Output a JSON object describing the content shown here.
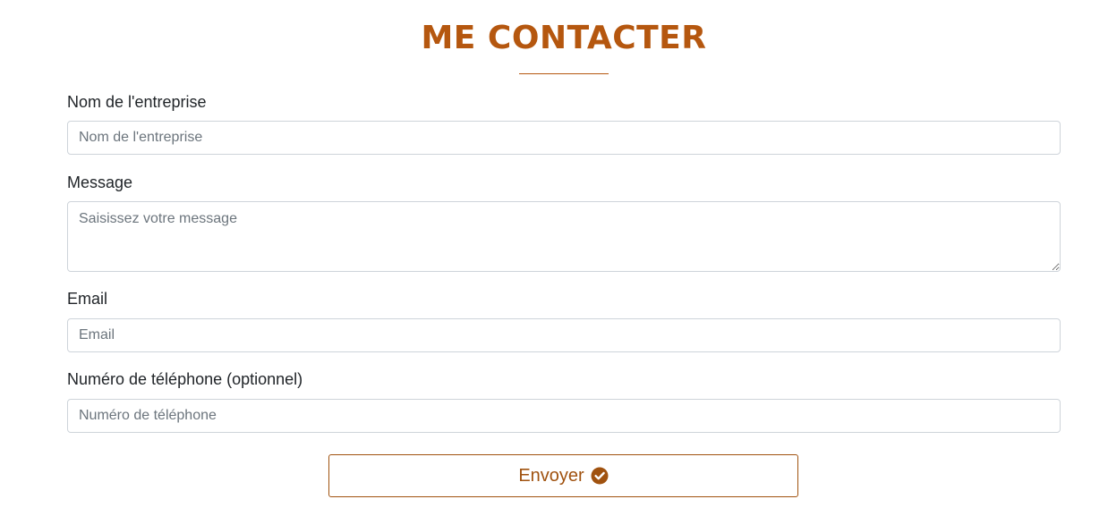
{
  "header": {
    "title": "ME CONTACTER"
  },
  "form": {
    "company": {
      "label": "Nom de l'entreprise",
      "placeholder": "Nom de l'entreprise",
      "value": ""
    },
    "message": {
      "label": "Message",
      "placeholder": "Saisissez votre message",
      "value": ""
    },
    "email": {
      "label": "Email",
      "placeholder": "Email",
      "value": ""
    },
    "phone": {
      "label": "Numéro de téléphone (optionnel)",
      "placeholder": "Numéro de téléphone",
      "value": ""
    },
    "submit": {
      "label": "Envoyer",
      "icon": "check-circle-icon"
    }
  },
  "colors": {
    "accent": "#b5570f",
    "button_text": "#a0520f",
    "border": "#ced4da",
    "placeholder": "#6c757d",
    "label_text": "#212529"
  }
}
